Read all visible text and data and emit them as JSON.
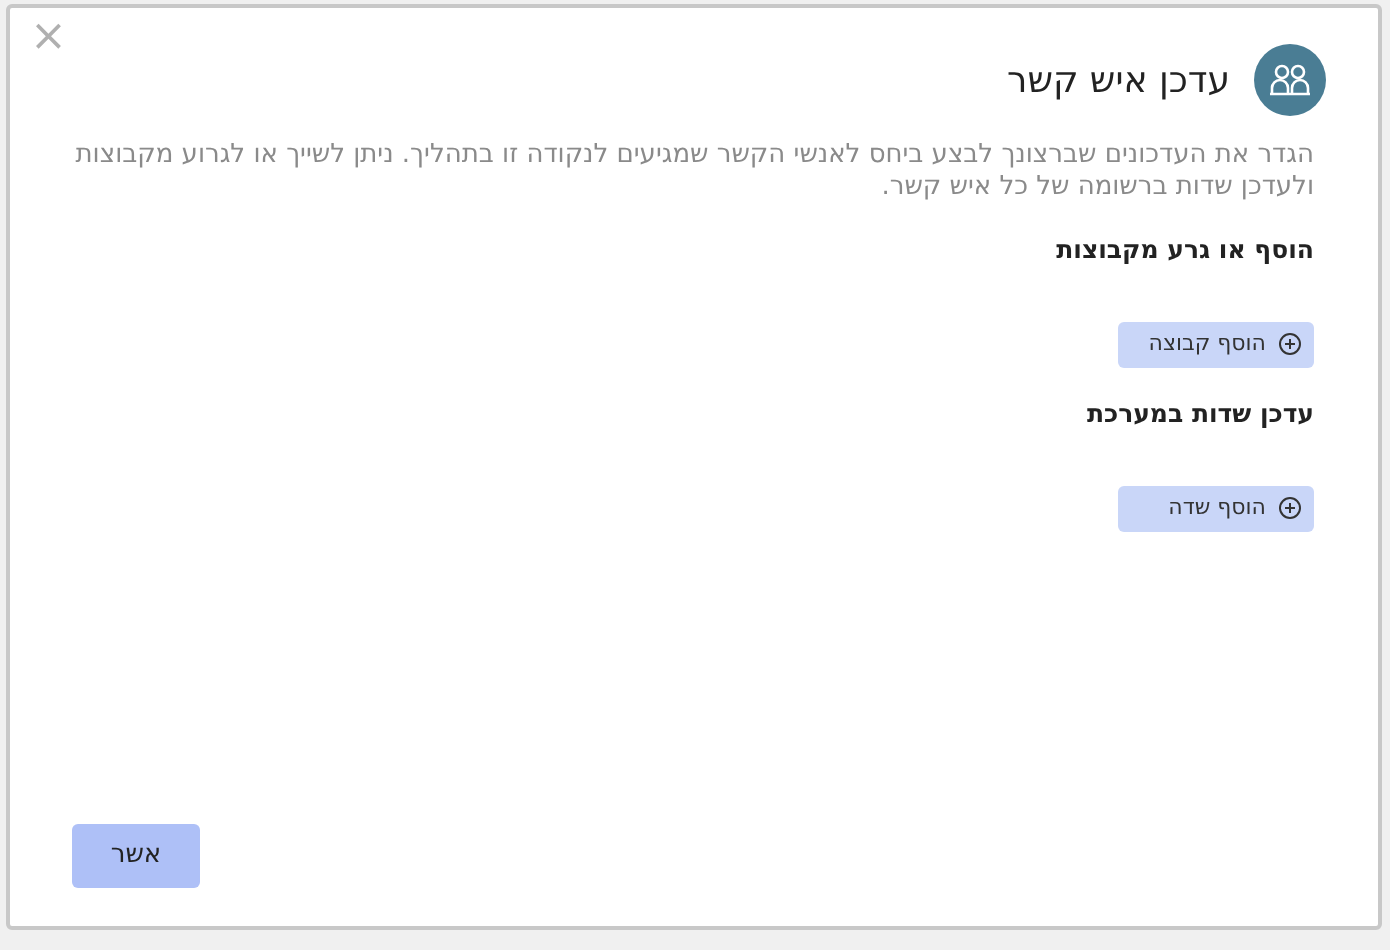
{
  "dialog": {
    "close": "×",
    "title": "עדכן איש קשר",
    "description": "הגדר את העדכונים שברצונך לבצע ביחס לאנשי הקשר שמגיעים לנקודה זו בתהליך. ניתן לשייך או לגרוע מקבוצות ולעדכן שדות ברשומה של כל איש קשר.",
    "sections": [
      {
        "heading": "הוסף או גרע מקבוצות",
        "button": "הוסף קבוצה"
      },
      {
        "heading": "עדכן שדות במערכת",
        "button": "הוסף שדה"
      }
    ],
    "confirm": "אשר"
  }
}
